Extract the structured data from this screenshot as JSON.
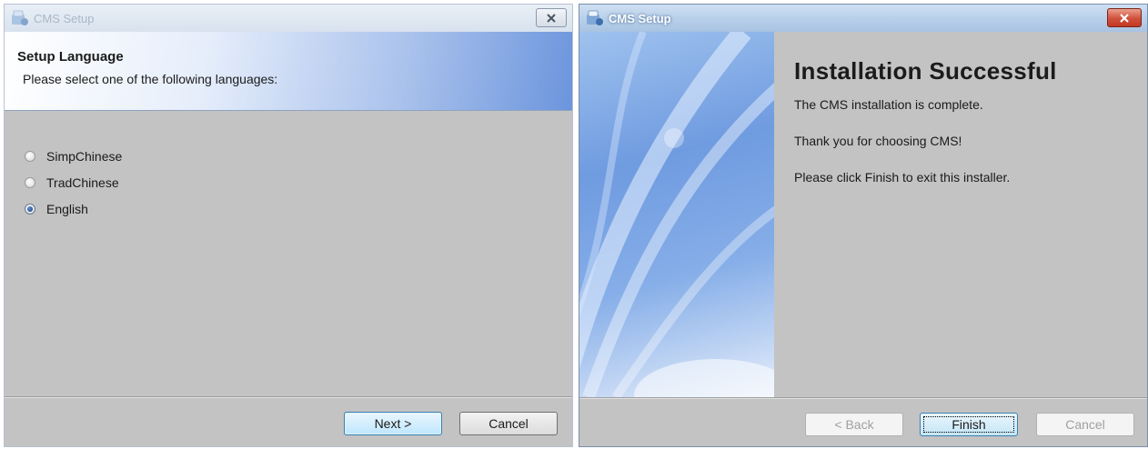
{
  "window1": {
    "title": "CMS Setup",
    "header": {
      "title": "Setup Language",
      "subtitle": "Please select one of the following languages:"
    },
    "languages": [
      {
        "label": "SimpChinese",
        "checked": false
      },
      {
        "label": "TradChinese",
        "checked": false
      },
      {
        "label": "English",
        "checked": true
      }
    ],
    "buttons": {
      "next": {
        "label": "Next >",
        "mnemonic": "N"
      },
      "cancel": {
        "label": "Cancel",
        "mnemonic": "C"
      }
    }
  },
  "window2": {
    "title": "CMS Setup",
    "heading": "Installation Successful",
    "lines": [
      "The CMS  installation is complete.",
      "Thank you for choosing CMS!",
      "Please click Finish to exit this installer."
    ],
    "buttons": {
      "back": {
        "label": "< Back",
        "mnemonic": "B",
        "enabled": false
      },
      "finish": {
        "label": "Finish",
        "mnemonic": "F",
        "enabled": true
      },
      "cancel": {
        "label": "Cancel",
        "mnemonic": "C",
        "enabled": false
      }
    }
  },
  "colors": {
    "dialog_body": "#c3c3c3",
    "header_gradient_end": "#6c95dd",
    "close_button_red": "#c23a22"
  },
  "icons": [
    "app-icon",
    "close-icon",
    "radio-button"
  ]
}
